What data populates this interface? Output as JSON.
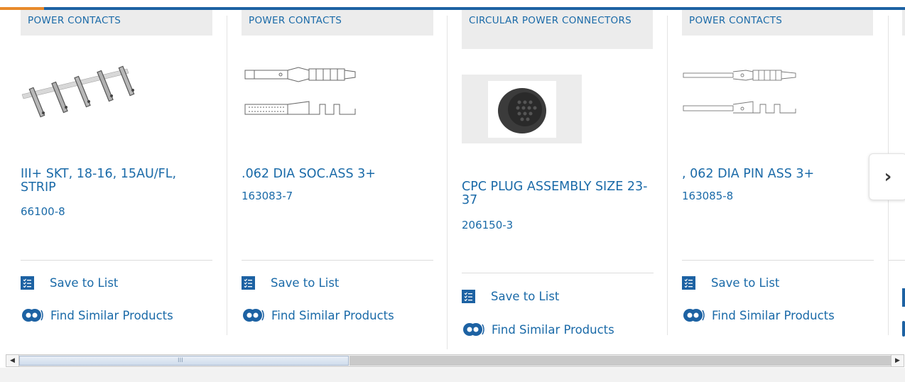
{
  "products": [
    {
      "category": "POWER CONTACTS",
      "title": "III+ SKT, 18-16, 15AU/FL, STRIP",
      "part_number": "66100-8",
      "save_label": "Save to List",
      "similar_label": "Find Similar Products",
      "image": "strip-contacts-photo"
    },
    {
      "category": "POWER CONTACTS",
      "title": ".062 DIA SOC.ASS 3+",
      "part_number": "163083-7",
      "save_label": "Save to List",
      "similar_label": "Find Similar Products",
      "image": "socket-contact-drawing"
    },
    {
      "category": "CIRCULAR POWER CONNECTORS",
      "title": "CPC PLUG ASSEMBLY SIZE 23-37",
      "part_number": "206150-3",
      "save_label": "Save to List",
      "similar_label": "Find Similar Products",
      "image": "circular-plug-photo"
    },
    {
      "category": "POWER CONTACTS",
      "title": ", 062 DIA PIN ASS 3+",
      "part_number": "163085-8",
      "save_label": "Save to List",
      "similar_label": "Find Similar Products",
      "image": "pin-contact-drawing"
    }
  ],
  "carousel": {
    "next_icon": "chevron-right-icon",
    "next_glyph": "›"
  },
  "scrollbar": {
    "left_arrow": "◀",
    "right_arrow": "▶",
    "grip": "III"
  },
  "colors": {
    "brand_blue": "#1d62a3",
    "accent_orange": "#e88a2b",
    "link_blue": "#1a6aa8",
    "category_bg": "#ececec"
  }
}
